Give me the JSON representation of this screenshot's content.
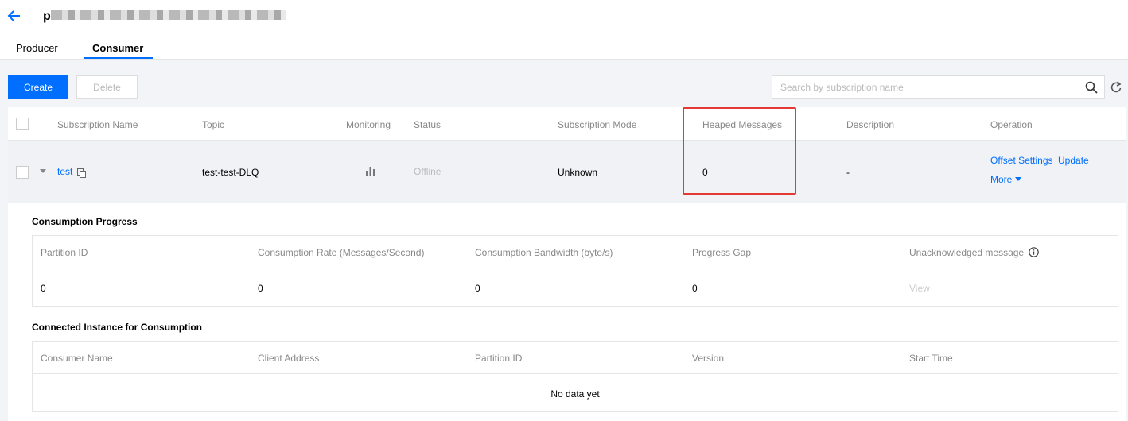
{
  "header": {
    "title_initial": "p",
    "tabs": [
      {
        "label": "Producer",
        "active": false
      },
      {
        "label": "Consumer",
        "active": true
      }
    ]
  },
  "toolbar": {
    "create_label": "Create",
    "delete_label": "Delete",
    "search_placeholder": "Search by subscription name"
  },
  "table": {
    "columns": [
      "Subscription Name",
      "Topic",
      "Monitoring",
      "Status",
      "Subscription Mode",
      "Heaped Messages",
      "Description",
      "Operation"
    ],
    "rows": [
      {
        "name": "test",
        "topic": "test-test-DLQ",
        "status": "Offline",
        "mode": "Unknown",
        "heaped": "0",
        "description": "-",
        "ops": [
          "Offset Settings",
          "Update",
          "More"
        ]
      }
    ]
  },
  "progress": {
    "title": "Consumption Progress",
    "columns": [
      "Partition ID",
      "Consumption Rate (Messages/Second)",
      "Consumption Bandwidth (byte/s)",
      "Progress Gap",
      "Unacknowledged message"
    ],
    "rows": [
      {
        "partition": "0",
        "rate": "0",
        "bandwidth": "0",
        "gap": "0",
        "unack": "View"
      }
    ]
  },
  "instances": {
    "title": "Connected Instance for Consumption",
    "columns": [
      "Consumer Name",
      "Client Address",
      "Partition ID",
      "Version",
      "Start Time"
    ],
    "empty_text": "No data yet"
  },
  "colors": {
    "accent": "#006eff",
    "highlight": "#e53935"
  },
  "icons": [
    "back-arrow-icon",
    "copy-icon",
    "bar-chart-icon",
    "search-icon",
    "refresh-icon",
    "info-icon",
    "caret-down-icon"
  ]
}
